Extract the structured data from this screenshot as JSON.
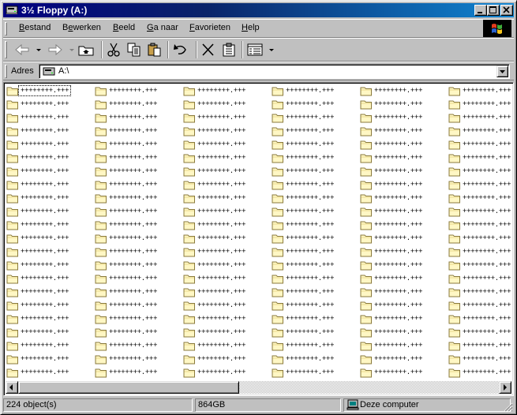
{
  "window": {
    "title": "3½ Floppy (A:)",
    "controls": {
      "minimize_icon": "minimize-icon",
      "maximize_icon": "maximize-icon",
      "close_icon": "close-icon"
    }
  },
  "menubar": {
    "items": [
      {
        "label": "Bestand",
        "accel": "B"
      },
      {
        "label": "Bewerken",
        "accel": "e"
      },
      {
        "label": "Beeld",
        "accel": "B"
      },
      {
        "label": "Ga naar",
        "accel": "G"
      },
      {
        "label": "Favorieten",
        "accel": "F"
      },
      {
        "label": "Help",
        "accel": "H"
      }
    ]
  },
  "toolbar": {
    "buttons": [
      {
        "name": "back",
        "icon": "back-arrow-icon"
      },
      {
        "name": "forward",
        "icon": "forward-arrow-icon"
      },
      {
        "name": "up",
        "icon": "up-folder-icon"
      },
      {
        "name": "cut",
        "icon": "scissors-icon"
      },
      {
        "name": "copy",
        "icon": "copy-icon"
      },
      {
        "name": "paste",
        "icon": "paste-icon"
      },
      {
        "name": "undo",
        "icon": "undo-icon"
      },
      {
        "name": "delete",
        "icon": "delete-x-icon"
      },
      {
        "name": "properties",
        "icon": "properties-icon"
      },
      {
        "name": "views",
        "icon": "views-icon"
      }
    ]
  },
  "address": {
    "label": "Adres",
    "value": "A:\\"
  },
  "files": {
    "columns": 6,
    "rows": 22,
    "item_label": "++++++++.+++",
    "icon": "folder-icon"
  },
  "statusbar": {
    "objects": "224 object(s)",
    "size": "864GB",
    "zone": "Deze computer"
  },
  "colors": {
    "titlebar_start": "#000080",
    "titlebar_end": "#1084d0",
    "window_face": "#c0c0c0",
    "folder_fill": "#fff7c4",
    "folder_edge": "#8a7a3c"
  }
}
